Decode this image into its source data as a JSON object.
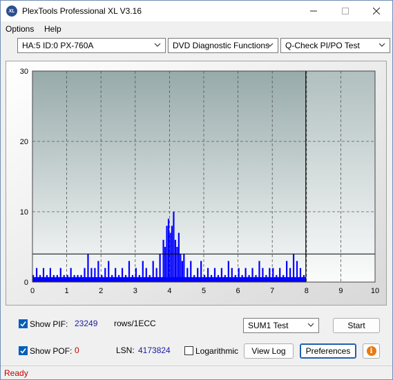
{
  "window": {
    "title": "PlexTools Professional XL V3.16",
    "icon_text": "XL",
    "controls": [
      "minimize-icon",
      "maximize-icon",
      "close-icon"
    ]
  },
  "menu": {
    "items": [
      {
        "label": "Options"
      },
      {
        "label": "Help"
      }
    ]
  },
  "toolbar": {
    "drive_select": "HA:5 ID:0  PX-760A",
    "function_select": "DVD Diagnostic Functions",
    "test_select": "Q-Check PI/PO Test"
  },
  "chart_data": {
    "type": "bar",
    "xlim": [
      0,
      10
    ],
    "ylim": [
      0,
      30
    ],
    "x_ticks": [
      0,
      1,
      2,
      3,
      4,
      5,
      6,
      7,
      8,
      9,
      10
    ],
    "y_ticks": [
      0,
      10,
      20,
      30
    ],
    "grid": true,
    "threshold_line": 4,
    "data_end_x": 7.98,
    "series": [
      {
        "color": "#0000ff",
        "x": [
          0.0,
          0.1,
          0.2,
          0.3,
          0.4,
          0.5,
          0.6,
          0.7,
          0.8,
          0.9,
          1.0,
          1.1,
          1.2,
          1.3,
          1.4,
          1.5,
          1.6,
          1.7,
          1.8,
          1.9,
          2.0,
          2.1,
          2.2,
          2.3,
          2.4,
          2.5,
          2.6,
          2.7,
          2.8,
          2.9,
          3.0,
          3.1,
          3.2,
          3.3,
          3.4,
          3.5,
          3.6,
          3.7,
          3.8,
          3.85,
          3.9,
          3.95,
          4.0,
          4.05,
          4.1,
          4.15,
          4.2,
          4.25,
          4.3,
          4.35,
          4.4,
          4.5,
          4.6,
          4.7,
          4.8,
          4.9,
          5.0,
          5.1,
          5.2,
          5.3,
          5.4,
          5.5,
          5.6,
          5.7,
          5.8,
          5.9,
          6.0,
          6.1,
          6.2,
          6.3,
          6.4,
          6.5,
          6.6,
          6.7,
          6.8,
          6.9,
          7.0,
          7.1,
          7.2,
          7.3,
          7.4,
          7.5,
          7.6,
          7.7,
          7.8,
          7.9
        ],
        "values": [
          1,
          2,
          1,
          2,
          1,
          2,
          1,
          1,
          2,
          1,
          1,
          2,
          1,
          1,
          1,
          2,
          4,
          2,
          2,
          3,
          1,
          2,
          3,
          1,
          2,
          1,
          2,
          1,
          3,
          1,
          2,
          1,
          3,
          2,
          1,
          3,
          2,
          4,
          6,
          5,
          8,
          9,
          7,
          8,
          10,
          6,
          5,
          7,
          4,
          3,
          4,
          2,
          3,
          1,
          2,
          3,
          1,
          2,
          1,
          2,
          1,
          2,
          1,
          3,
          2,
          1,
          2,
          1,
          2,
          1,
          2,
          1,
          3,
          2,
          1,
          2,
          2,
          1,
          2,
          1,
          3,
          2,
          4,
          3,
          2,
          1
        ]
      }
    ]
  },
  "controls": {
    "show_pif_label": "Show PIF:",
    "pif_value": "23249",
    "pif_unit": "rows/1ECC",
    "show_pof_label": "Show POF:",
    "pof_value": "0",
    "lsn_label": "LSN:",
    "lsn_value": "4173824",
    "logarithmic_label": "Logarithmic",
    "sum_select": "SUM1 Test",
    "start_label": "Start",
    "view_log_label": "View Log",
    "preferences_label": "Preferences"
  },
  "status": {
    "text": "Ready"
  }
}
